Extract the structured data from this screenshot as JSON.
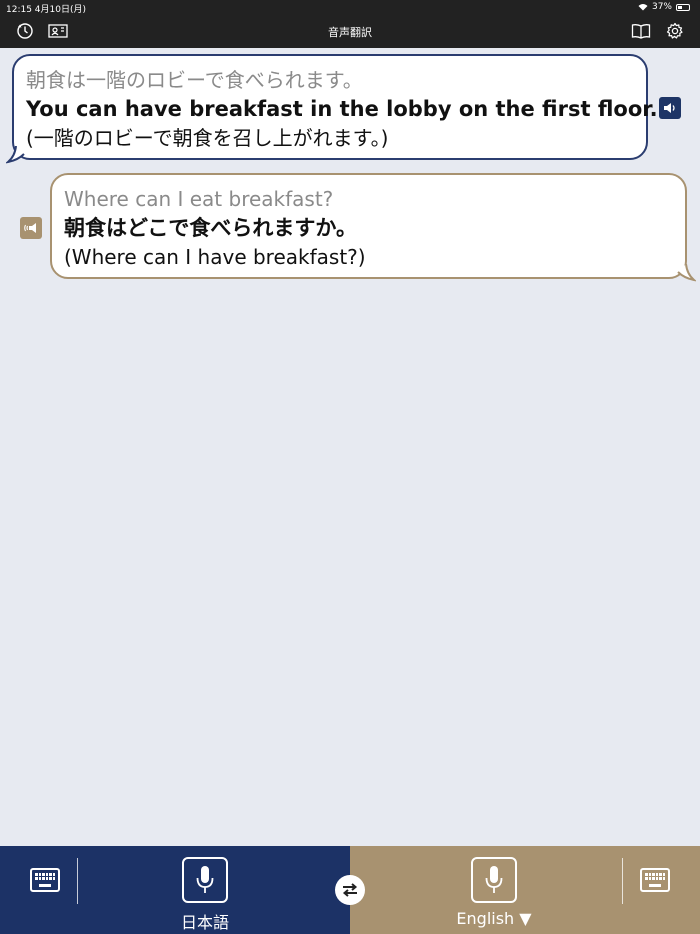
{
  "status": {
    "time": "12:15  4月10日(月)",
    "battery": "37%"
  },
  "nav": {
    "title": "音声翻訳"
  },
  "conversation": [
    {
      "source": "朝食は一階のロビーで食べられます。",
      "translation": "You can have breakfast in the lobby on the first floor.",
      "back_translation": "(一階のロビーで朝食を召し上がれます。)"
    },
    {
      "source": "Where can I eat breakfast?",
      "translation": "朝食はどこで食べられますか。",
      "back_translation": "(Where can I have breakfast?)"
    }
  ],
  "bottom": {
    "left_language": "日本語",
    "right_language": "English ▼"
  },
  "colors": {
    "japanese_side": "#1c3266",
    "english_side": "#a89270",
    "background": "#e7eaf1"
  }
}
